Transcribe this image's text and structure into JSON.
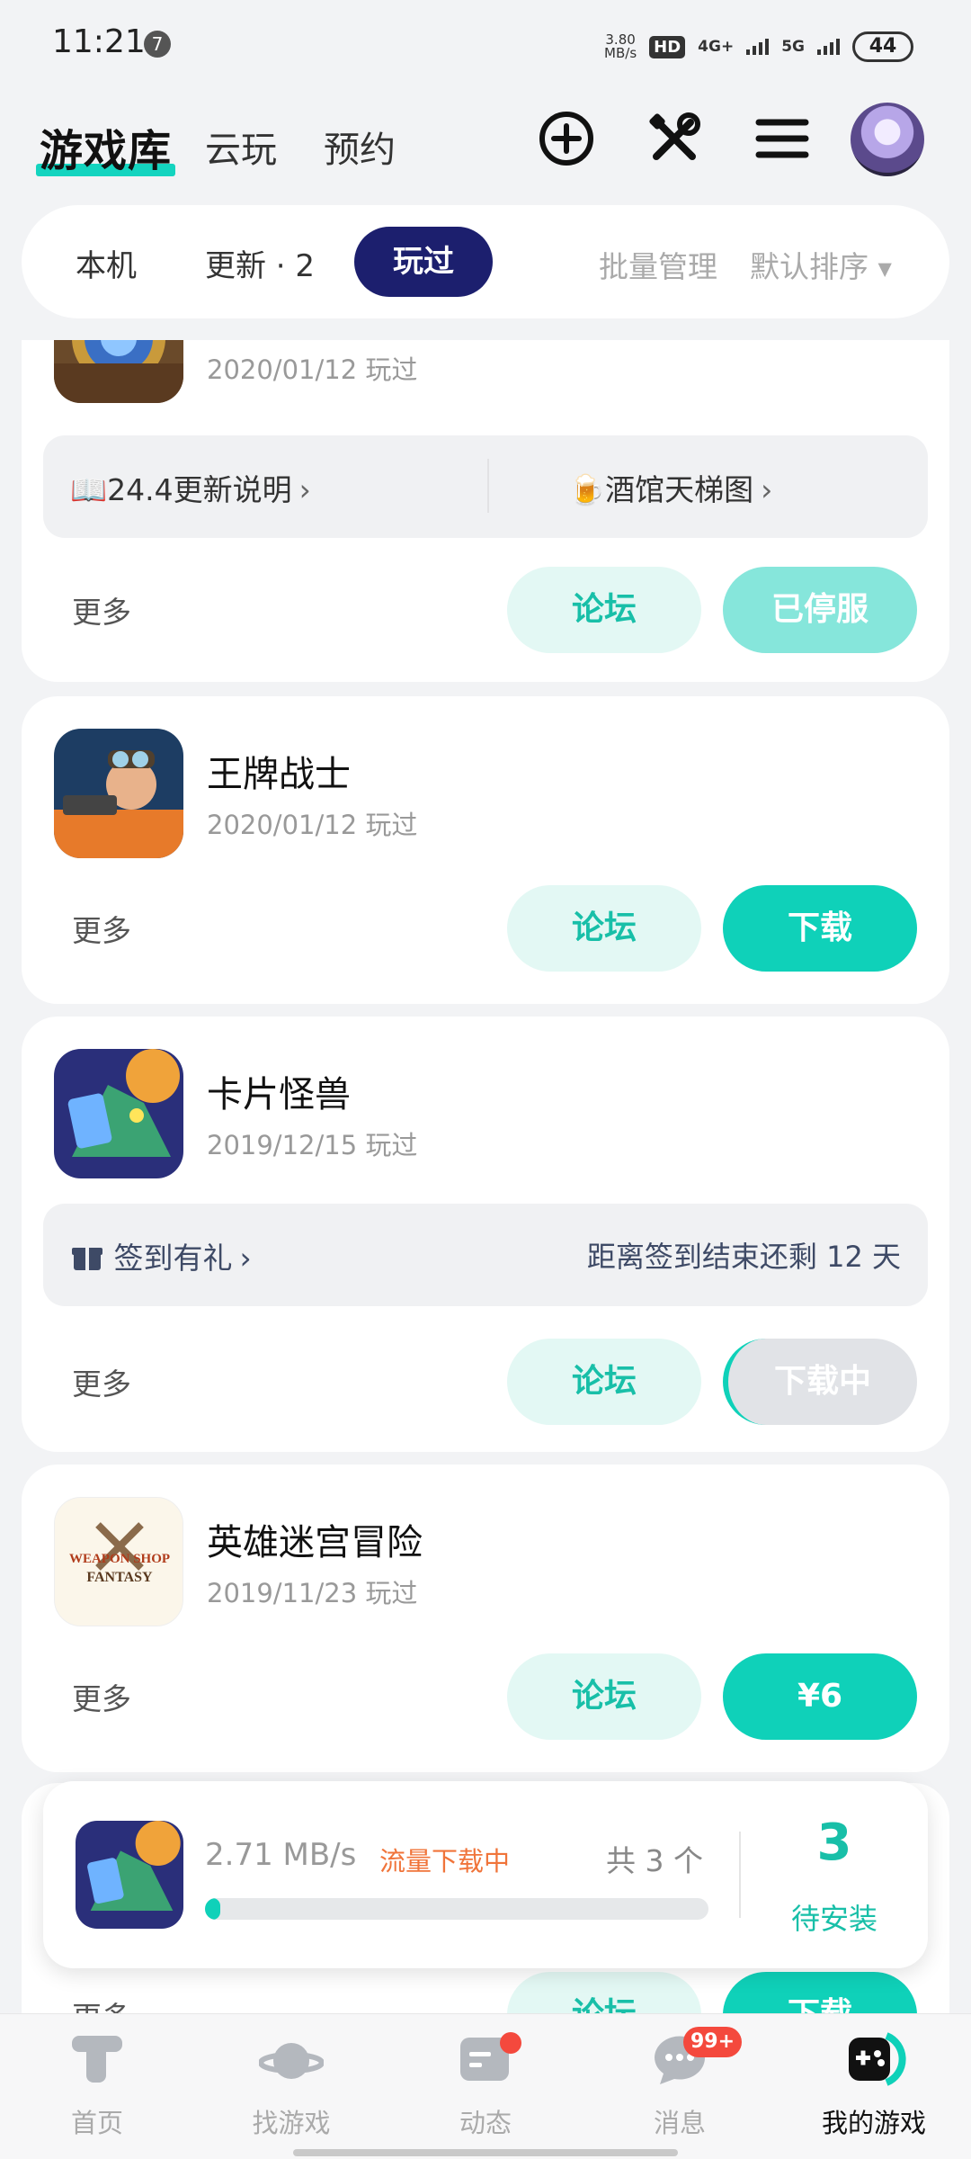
{
  "status_bar": {
    "time": "11:21",
    "notification_count": "7",
    "speed_value": "3.80",
    "speed_unit": "MB/s",
    "hd_label": "HD",
    "network_1": "4G+",
    "network_2": "5G",
    "battery": "44"
  },
  "header": {
    "title": "游戏库",
    "tabs": [
      "云玩",
      "预约"
    ],
    "icons": [
      "add-circle-icon",
      "tools-icon",
      "menu-icon"
    ]
  },
  "filter_bar": {
    "tabs": [
      "本机",
      "更新 · 2",
      "玩过"
    ],
    "active_tab": "玩过",
    "batch_manage": "批量管理",
    "sort": "默认排序"
  },
  "games": [
    {
      "name": "",
      "date": "2020/01/12 玩过",
      "info_left": "24.4更新说明",
      "info_right": "酒馆天梯图",
      "more": "更多",
      "forum": "论坛",
      "action": "已停服"
    },
    {
      "name": "王牌战士",
      "date": "2020/01/12 玩过",
      "more": "更多",
      "forum": "论坛",
      "action": "下载"
    },
    {
      "name": "卡片怪兽",
      "date": "2019/12/15 玩过",
      "info_left": "签到有礼",
      "info_right": "距离签到结束还剩 12 天",
      "more": "更多",
      "forum": "论坛",
      "action": "下载中"
    },
    {
      "name": "英雄迷宫冒险",
      "date": "2019/11/23 玩过",
      "icon_text_1": "WEAPON SHOP",
      "icon_text_2": "FANTASY",
      "more": "更多",
      "forum": "论坛",
      "action": "¥6"
    },
    {
      "more": "更多",
      "forum": "论坛",
      "action": "下载"
    }
  ],
  "download_bar": {
    "speed": "2.71 MB/s",
    "status": "流量下载中",
    "count": "共 3 个",
    "progress": 0.03,
    "pending_num": "3",
    "pending_label": "待安装"
  },
  "bottom_nav": {
    "items": [
      "首页",
      "找游戏",
      "动态",
      "消息",
      "我的游戏"
    ],
    "active": "我的游戏",
    "message_badge": "99+"
  },
  "colors": {
    "accent": "#0fd1b9",
    "accent_text": "#18bfa8",
    "active_tab_bg": "#1c1f6e",
    "warning_text": "#f0743a"
  }
}
